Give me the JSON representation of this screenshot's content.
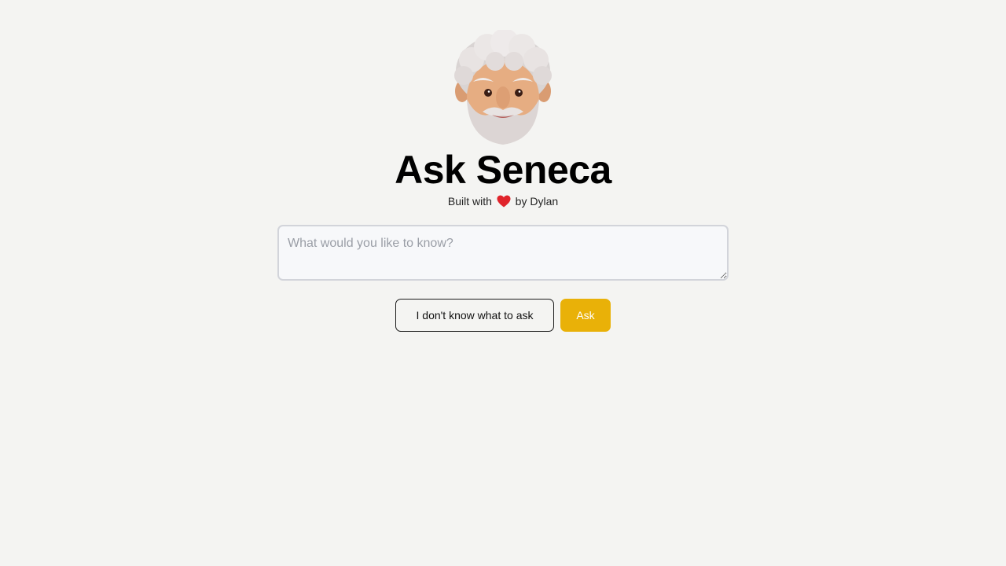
{
  "header": {
    "title": "Ask Seneca",
    "subtitle_prefix": "Built with",
    "subtitle_suffix": "by Dylan"
  },
  "question": {
    "value": "",
    "placeholder": "What would you like to know?"
  },
  "actions": {
    "random_label": "I don't know what to ask",
    "ask_label": "Ask"
  },
  "colors": {
    "background": "#f4f4f2",
    "accent": "#e9b108",
    "heart": "#e0242b"
  },
  "icons": {
    "avatar": "seneca-bearded-avatar",
    "heart": "red-heart-icon"
  }
}
